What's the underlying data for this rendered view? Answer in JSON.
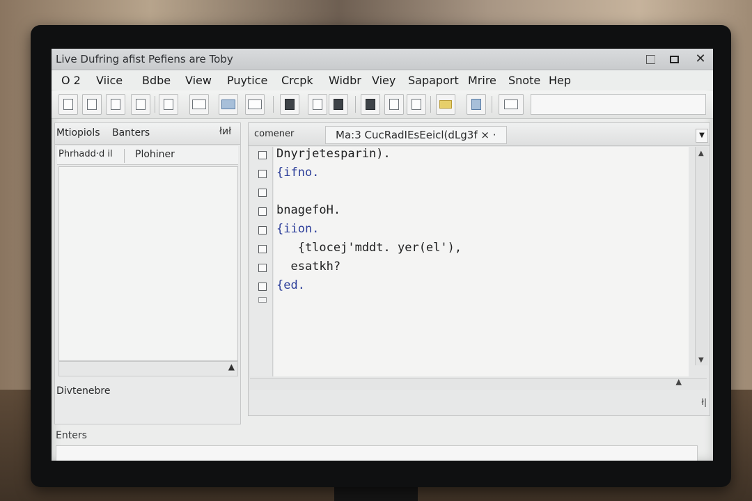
{
  "window": {
    "title": "Live Dufring afist Pefiens are Toby"
  },
  "menu": {
    "items": [
      "O 2",
      "Viice",
      "Bdbe",
      "View",
      "Puytice",
      "Crcpk",
      "Widbr",
      "Viey",
      "Sapaport",
      "Mrire",
      "Snote",
      "Hep"
    ]
  },
  "left_panel": {
    "tab1": "Mtiopiols",
    "tab2": "Banters",
    "pin": "łиł",
    "col1": "Phrhadd·d il",
    "col2": "Plohiner",
    "footer": "Divtenebre"
  },
  "editor": {
    "tab1": "comener",
    "tab2": "Ma:3 CucRadIEsEeicl(dLg3f",
    "tab2_close": "× ·",
    "code_lines": [
      {
        "text": "Dnyrjetesparin).",
        "color": "dark"
      },
      {
        "text": "{ifno.",
        "color": "blue"
      },
      {
        "text": "",
        "color": "dark"
      },
      {
        "text": "bnagefoH.",
        "color": "dark"
      },
      {
        "text": "{iion.",
        "color": "blue"
      },
      {
        "text": "   {tlocej'mddt. yer(el'),",
        "color": "dark"
      },
      {
        "text": "  esatkh?",
        "color": "dark"
      },
      {
        "text": "{ed.",
        "color": "blue"
      }
    ],
    "status_glyph": "ł|"
  },
  "output": {
    "label": "Enters"
  }
}
